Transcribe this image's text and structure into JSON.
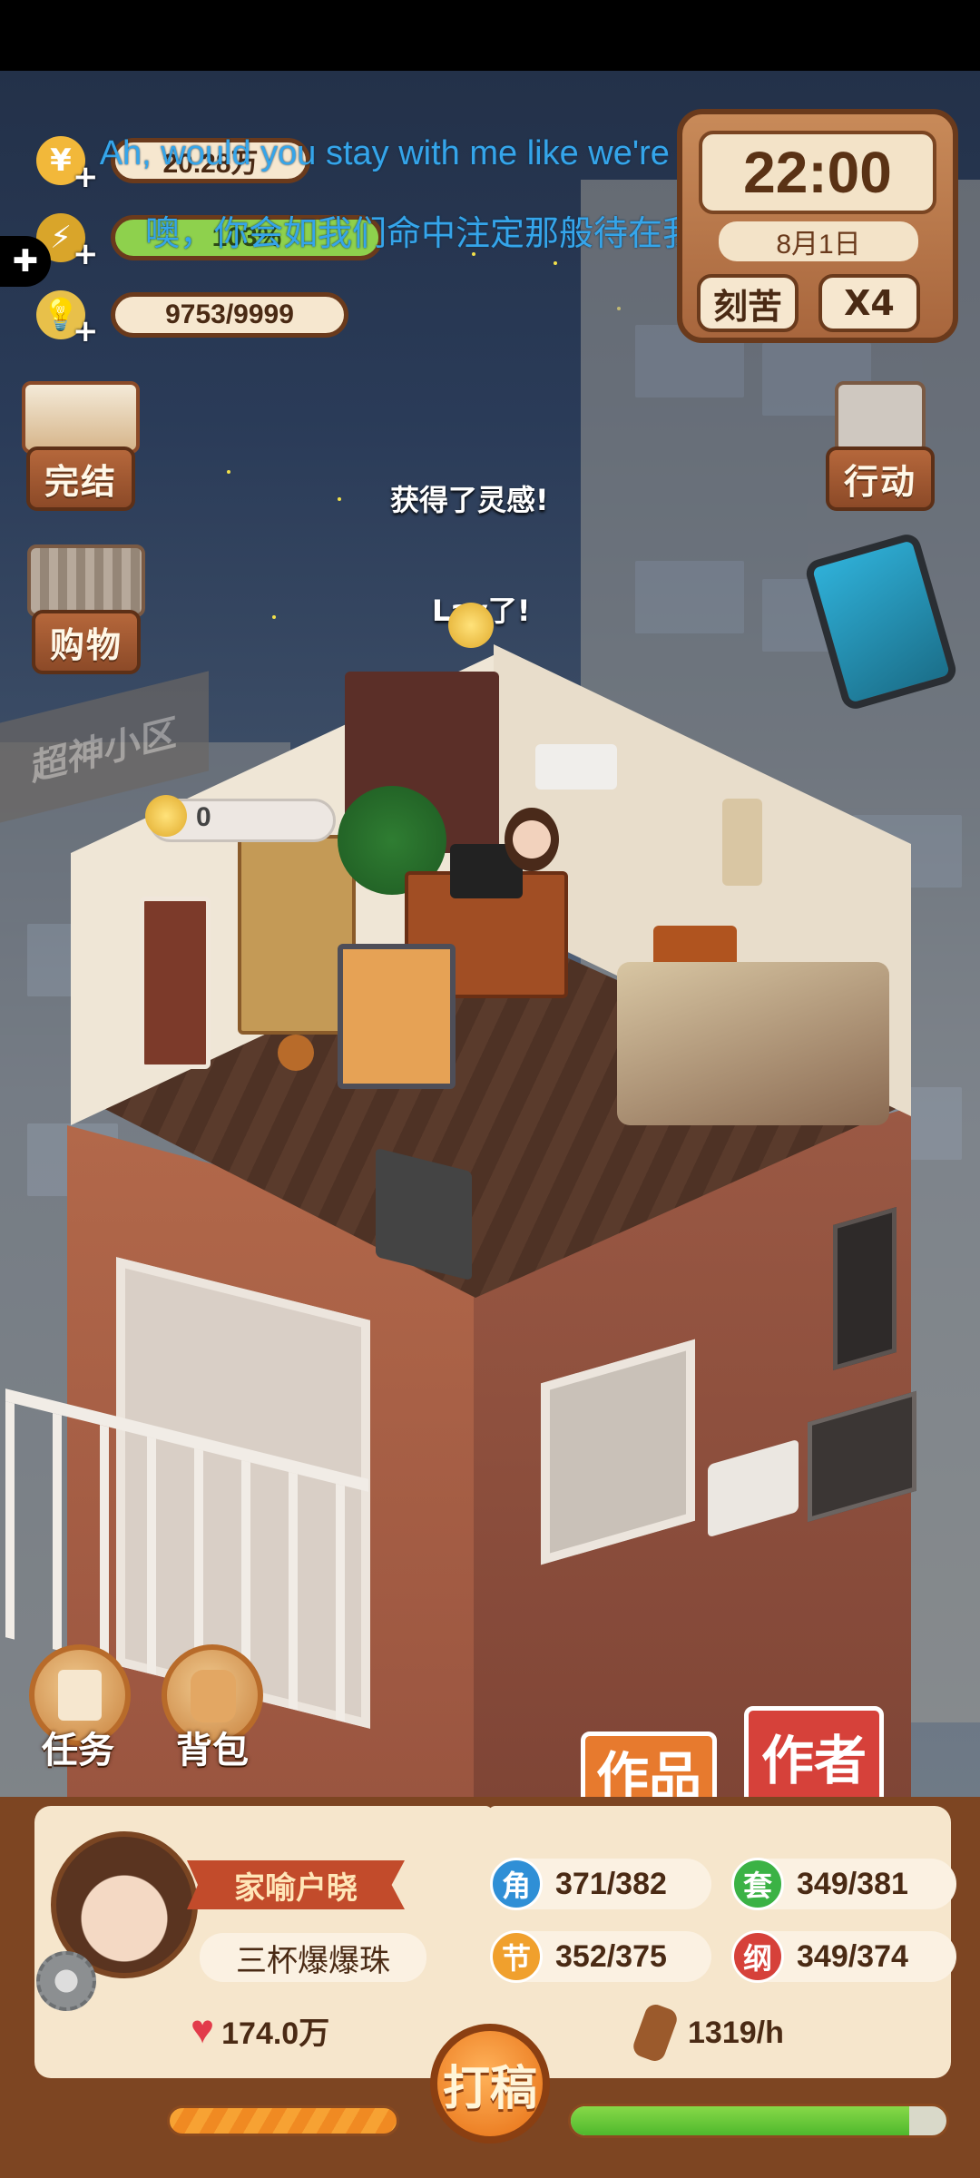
{
  "hud": {
    "coins": "20.28万",
    "energy": "103%",
    "inspiration": "9753/9999"
  },
  "clock": {
    "time": "22:00",
    "date": "8月1日",
    "mode_button": "刻苦",
    "speed_button": "X4"
  },
  "subtitles": {
    "english": "Ah, would you stay with me like we're meant to be?",
    "chinese": "噢，你会如我们命中注定那般待在我身边吗？"
  },
  "side_left": [
    {
      "label": "完结",
      "icon": "book-icon"
    },
    {
      "label": "购物",
      "icon": "basket-icon"
    }
  ],
  "side_right": [
    {
      "label": "行动",
      "icon": "sign-icon"
    },
    {
      "icon": "tablet-icon"
    }
  ],
  "scene": {
    "inspiration_popup": "获得了灵感!",
    "lay_popup": "Lay了!",
    "bulb_counter": "0",
    "background_sign": "超神小区"
  },
  "round_buttons": [
    {
      "label": "任务",
      "icon": "task-scroll-icon"
    },
    {
      "label": "背包",
      "icon": "backpack-icon"
    }
  ],
  "tabs": {
    "works": "作品",
    "author": "作者"
  },
  "profile": {
    "name": "家喻户晓",
    "subtitle": "三杯爆爆珠",
    "fans": "174.0万"
  },
  "metrics": [
    {
      "badge": "角",
      "value": "371/382",
      "color": "#2f8fd6"
    },
    {
      "badge": "套",
      "value": "349/381",
      "color": "#3bb245"
    },
    {
      "badge": "节",
      "value": "352/375",
      "color": "#f0a02d"
    },
    {
      "badge": "纲",
      "value": "349/374",
      "color": "#d6413a"
    }
  ],
  "rate": "1319/h",
  "write_button": "打稿",
  "progress": {
    "left_fraction": 1.0,
    "right_fraction": 0.9
  },
  "colors": {
    "panel_brown": "#7d4522",
    "subtitle_blue": "#35a5ea",
    "tab_red": "#d6413a",
    "tab_orange": "#e77a2e"
  }
}
